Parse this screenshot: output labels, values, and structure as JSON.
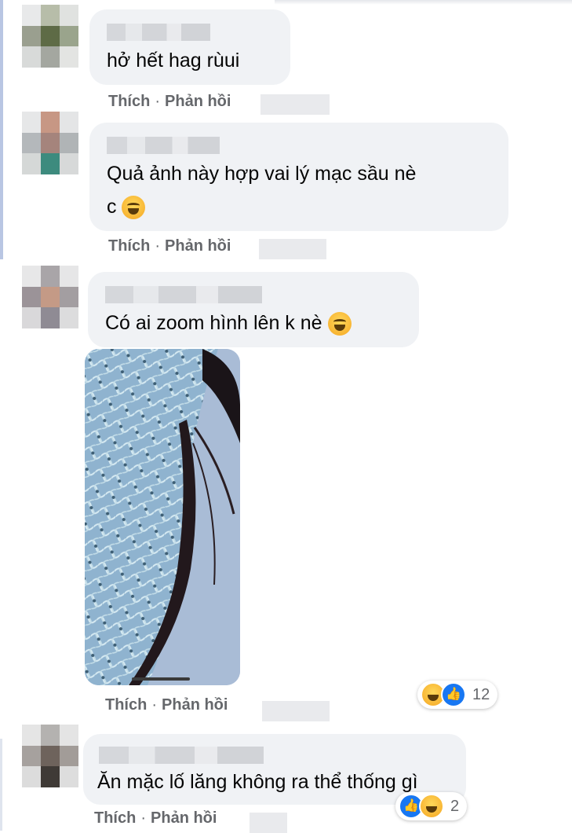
{
  "comments": [
    {
      "text": "hở hết hag rùui",
      "actions": {
        "like": "Thích",
        "reply": "Phản hồi",
        "dot": "·"
      }
    },
    {
      "text_line1": "Quả ảnh này hợp vai lý mạc sầu nè",
      "text_line2": "c",
      "emoji": "rolling-on-floor-laughing",
      "actions": {
        "like": "Thích",
        "reply": "Phản hồi",
        "dot": "·"
      }
    },
    {
      "text": "Có ai zoom hình lên k nè",
      "emoji": "face-with-tears-of-joy",
      "actions": {
        "like": "Thích",
        "reply": "Phản hồi",
        "dot": "·"
      },
      "reactions": {
        "types": [
          "haha",
          "like"
        ],
        "count": "12"
      }
    },
    {
      "text": "Ăn mặc lố lăng không ra thể thống gì",
      "actions": {
        "like": "Thích",
        "reply": "Phản hồi",
        "dot": "·"
      },
      "reactions": {
        "types": [
          "like",
          "haha"
        ],
        "count": "2"
      }
    }
  ],
  "colors": {
    "bubble": "#f0f2f5",
    "action_text": "#65676b",
    "like_blue": "#1877f2",
    "haha_yellow": "#f5a623"
  }
}
